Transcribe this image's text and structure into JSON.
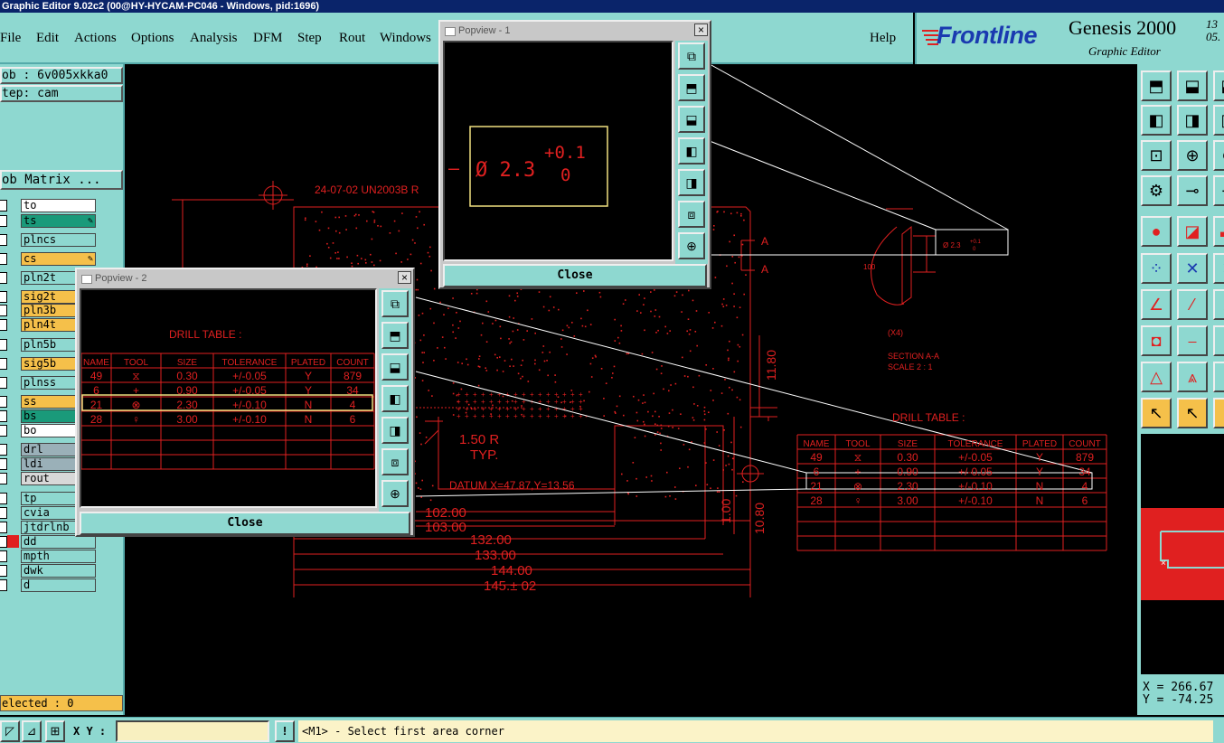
{
  "window": {
    "title": "Graphic Editor 9.02c2 (00@HY-HYCAM-PC046 - Windows, pid:1696)"
  },
  "menu": {
    "items": [
      "File",
      "Edit",
      "Actions",
      "Options",
      "Analysis",
      "DFM",
      "Step",
      "Rout",
      "Windows"
    ],
    "help": "Help"
  },
  "brand": {
    "logo": "Frontline",
    "product": "Genesis 2000",
    "subtitle": "Graphic Editor",
    "date_line1": "13",
    "date_line2": "05."
  },
  "left_panel": {
    "job": "ob : 6v005xkka0",
    "step": "tep: cam",
    "job_matrix": "ob Matrix ...",
    "layers": [
      {
        "name": "to",
        "color": "#ffffff",
        "editable": false
      },
      {
        "name": "ts",
        "color": "#1a9a7a",
        "editable": true
      },
      {
        "name": "plncs",
        "color": "#8ed8d0",
        "editable": false
      },
      {
        "name": "cs",
        "color": "#f5c04a",
        "editable": true
      },
      {
        "name": "pln2t",
        "color": "#8ed8d0",
        "editable": false
      },
      {
        "name": "sig2t",
        "color": "#f5c04a",
        "editable": true
      },
      {
        "name": "pln3b",
        "color": "#f5c04a",
        "editable": true
      },
      {
        "name": "pln4t",
        "color": "#f5c04a",
        "editable": true
      },
      {
        "name": "pln5b",
        "color": "#8ed8d0",
        "editable": false
      },
      {
        "name": "sig5b",
        "color": "#f5c04a",
        "editable": false
      },
      {
        "name": "plnss",
        "color": "#8ed8d0",
        "editable": false
      },
      {
        "name": "ss",
        "color": "#f5c04a",
        "editable": false
      },
      {
        "name": "bs",
        "color": "#1a9a7a",
        "editable": false
      },
      {
        "name": "bo",
        "color": "#ffffff",
        "editable": false
      },
      {
        "name": "drl",
        "color": "#9ab0b8",
        "editable": false
      },
      {
        "name": "ldi",
        "color": "#9ab0b8",
        "editable": false
      },
      {
        "name": "rout",
        "color": "#d8d8d8",
        "editable": false
      },
      {
        "name": "tp",
        "color": "#8ed8d0",
        "editable": false
      },
      {
        "name": "cvia",
        "color": "#8ed8d0",
        "editable": false
      },
      {
        "name": "jtdrlnb",
        "color": "#8ed8d0",
        "editable": false
      },
      {
        "name": "dd",
        "color": "#8ed8d0",
        "editable": false
      },
      {
        "name": "mpth",
        "color": "#8ed8d0",
        "editable": false
      },
      {
        "name": "dwk",
        "color": "#8ed8d0",
        "editable": false
      },
      {
        "name": "d",
        "color": "#8ed8d0",
        "editable": false
      }
    ],
    "selected": "elected : 0"
  },
  "coords": {
    "x": "X = 266.67",
    "y": "Y = -74.25"
  },
  "status": {
    "xy_label": "X Y :",
    "message": "<M1> - Select first area corner"
  },
  "drawing": {
    "header_text": "24-07-02 UN2003B R",
    "radius_text": "1.50 R",
    "typ_text": "TYP.",
    "datum_text": "DATUM X=47.87,Y=13.56",
    "dims": [
      "102.00",
      "103.00",
      "132.00",
      "133.00",
      "144.00",
      "145.± 02"
    ],
    "vert_dims": [
      "11.80",
      "1.00",
      "10.80"
    ],
    "section_label": "A",
    "section_text": "SECTION A-A",
    "scale_text": "SCALE 2 : 1",
    "x4_text": "(X4)",
    "angle_text": "100",
    "dia_small": "Ø 2.3",
    "dia_small_tol_top": "+0.1",
    "dia_small_tol_bot": "0"
  },
  "drill_table": {
    "title": "DRILL TABLE :",
    "headers": [
      "NAME",
      "TOOL",
      "SIZE",
      "TOLERANCE",
      "PLATED",
      "COUNT"
    ],
    "rows": [
      [
        "49",
        "⧖",
        "0.30",
        "+/-0.05",
        "Y",
        "879"
      ],
      [
        "6",
        "+",
        "0.90",
        "+/-0.05",
        "Y",
        "34"
      ],
      [
        "21",
        "⊗",
        "2.30",
        "+/-0.10",
        "N",
        "4"
      ],
      [
        "28",
        "♀",
        "3.00",
        "+/-0.10",
        "N",
        "6"
      ]
    ]
  },
  "popview1": {
    "title": "Popview - 1",
    "close": "Close",
    "dia": "Ø 2.3",
    "dash": "–",
    "tol_top": "+0.1",
    "tol_bot": "0"
  },
  "popview2": {
    "title": "Popview - 2",
    "close": "Close"
  },
  "colors": {
    "accent": "#8ed8d0",
    "drawing": "#e02020",
    "highlight": "#f0e080"
  }
}
